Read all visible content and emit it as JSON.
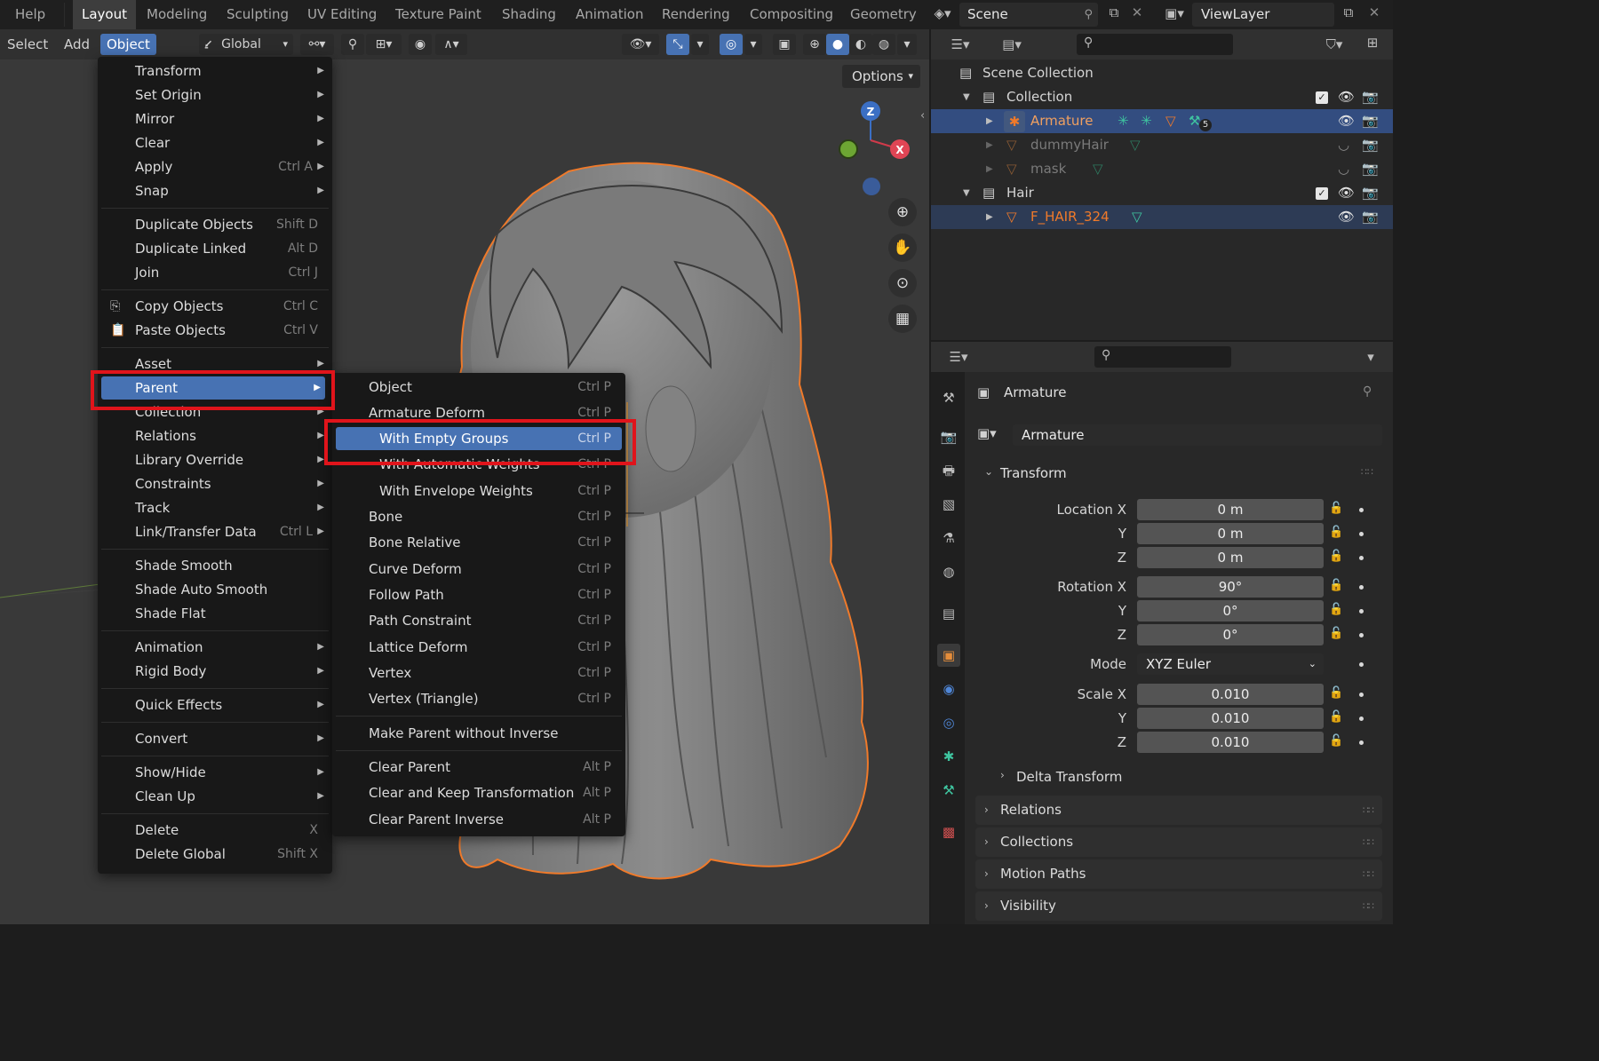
{
  "topbar": {
    "help": "Help",
    "workspaces": [
      "Layout",
      "Modeling",
      "Sculpting",
      "UV Editing",
      "Texture Paint",
      "Shading",
      "Animation",
      "Rendering",
      "Compositing",
      "Geometry"
    ],
    "scene": "Scene",
    "view_layer": "ViewLayer"
  },
  "viewport_header": {
    "select": "Select",
    "add": "Add",
    "object": "Object",
    "orientation": "Global"
  },
  "viewport": {
    "options": "Options",
    "gizmo_axes": [
      "Z",
      "X"
    ]
  },
  "object_menu": {
    "items": [
      {
        "label": "Transform",
        "submenu": true
      },
      {
        "label": "Set Origin",
        "submenu": true
      },
      {
        "label": "Mirror",
        "submenu": true
      },
      {
        "label": "Clear",
        "submenu": true
      },
      {
        "label": "Apply",
        "shortcut": "Ctrl A",
        "submenu": true
      },
      {
        "label": "Snap",
        "submenu": true
      },
      {
        "label": "Duplicate Objects",
        "shortcut": "Shift D"
      },
      {
        "label": "Duplicate Linked",
        "shortcut": "Alt D"
      },
      {
        "label": "Join",
        "shortcut": "Ctrl J"
      },
      {
        "label": "Copy Objects",
        "shortcut": "Ctrl C",
        "icon": "copy-icon"
      },
      {
        "label": "Paste Objects",
        "shortcut": "Ctrl V",
        "icon": "paste-icon"
      },
      {
        "label": "Asset",
        "submenu": true
      },
      {
        "label": "Parent",
        "submenu": true,
        "highlighted": true
      },
      {
        "label": "Collection",
        "submenu": true
      },
      {
        "label": "Relations",
        "submenu": true
      },
      {
        "label": "Library Override",
        "submenu": true
      },
      {
        "label": "Constraints",
        "submenu": true
      },
      {
        "label": "Track",
        "submenu": true
      },
      {
        "label": "Link/Transfer Data",
        "shortcut": "Ctrl L",
        "submenu": true
      },
      {
        "label": "Shade Smooth"
      },
      {
        "label": "Shade Auto Smooth"
      },
      {
        "label": "Shade Flat"
      },
      {
        "label": "Animation",
        "submenu": true
      },
      {
        "label": "Rigid Body",
        "submenu": true
      },
      {
        "label": "Quick Effects",
        "submenu": true
      },
      {
        "label": "Convert",
        "submenu": true
      },
      {
        "label": "Show/Hide",
        "submenu": true
      },
      {
        "label": "Clean Up",
        "submenu": true
      },
      {
        "label": "Delete",
        "shortcut": "X"
      },
      {
        "label": "Delete Global",
        "shortcut": "Shift X"
      }
    ]
  },
  "parent_menu": {
    "items": [
      {
        "label": "Object",
        "shortcut": "Ctrl P"
      },
      {
        "label": "Armature Deform",
        "shortcut": "Ctrl P"
      },
      {
        "label": "With Empty Groups",
        "shortcut": "Ctrl P",
        "highlighted": true
      },
      {
        "label": "With Automatic Weights",
        "shortcut": "Ctrl P"
      },
      {
        "label": "With Envelope Weights",
        "shortcut": "Ctrl P"
      },
      {
        "label": "Bone",
        "shortcut": "Ctrl P"
      },
      {
        "label": "Bone Relative",
        "shortcut": "Ctrl P"
      },
      {
        "label": "Curve Deform",
        "shortcut": "Ctrl P"
      },
      {
        "label": "Follow Path",
        "shortcut": "Ctrl P"
      },
      {
        "label": "Path Constraint",
        "shortcut": "Ctrl P"
      },
      {
        "label": "Lattice Deform",
        "shortcut": "Ctrl P"
      },
      {
        "label": "Vertex",
        "shortcut": "Ctrl P"
      },
      {
        "label": "Vertex (Triangle)",
        "shortcut": "Ctrl P"
      },
      {
        "label": "Make Parent without Inverse"
      },
      {
        "label": "Clear Parent",
        "shortcut": "Alt P"
      },
      {
        "label": "Clear and Keep Transformation",
        "shortcut": "Alt P"
      },
      {
        "label": "Clear Parent Inverse",
        "shortcut": "Alt P"
      }
    ]
  },
  "outliner": {
    "scene_collection": "Scene Collection",
    "rows": [
      {
        "label": "Collection"
      },
      {
        "label": "Armature",
        "badge": "5"
      },
      {
        "label": "dummyHair"
      },
      {
        "label": "mask"
      },
      {
        "label": "Hair"
      },
      {
        "label": "F_HAIR_324"
      }
    ]
  },
  "properties": {
    "object_name": "Armature",
    "data_name": "Armature",
    "transform_title": "Transform",
    "location_label": "Location X",
    "rotation_label": "Rotation X",
    "scale_label": "Scale X",
    "axis_y": "Y",
    "axis_z": "Z",
    "location": [
      "0 m",
      "0 m",
      "0 m"
    ],
    "rotation": [
      "90°",
      "0°",
      "0°"
    ],
    "mode_label": "Mode",
    "mode_value": "XYZ Euler",
    "scale": [
      "0.010",
      "0.010",
      "0.010"
    ],
    "delta_transform": "Delta Transform",
    "panels": [
      "Relations",
      "Collections",
      "Motion Paths",
      "Visibility"
    ]
  },
  "colors": {
    "accent": "#4772b3",
    "selection_orange": "#f07a2a",
    "highlight_box": "#e0141b"
  }
}
